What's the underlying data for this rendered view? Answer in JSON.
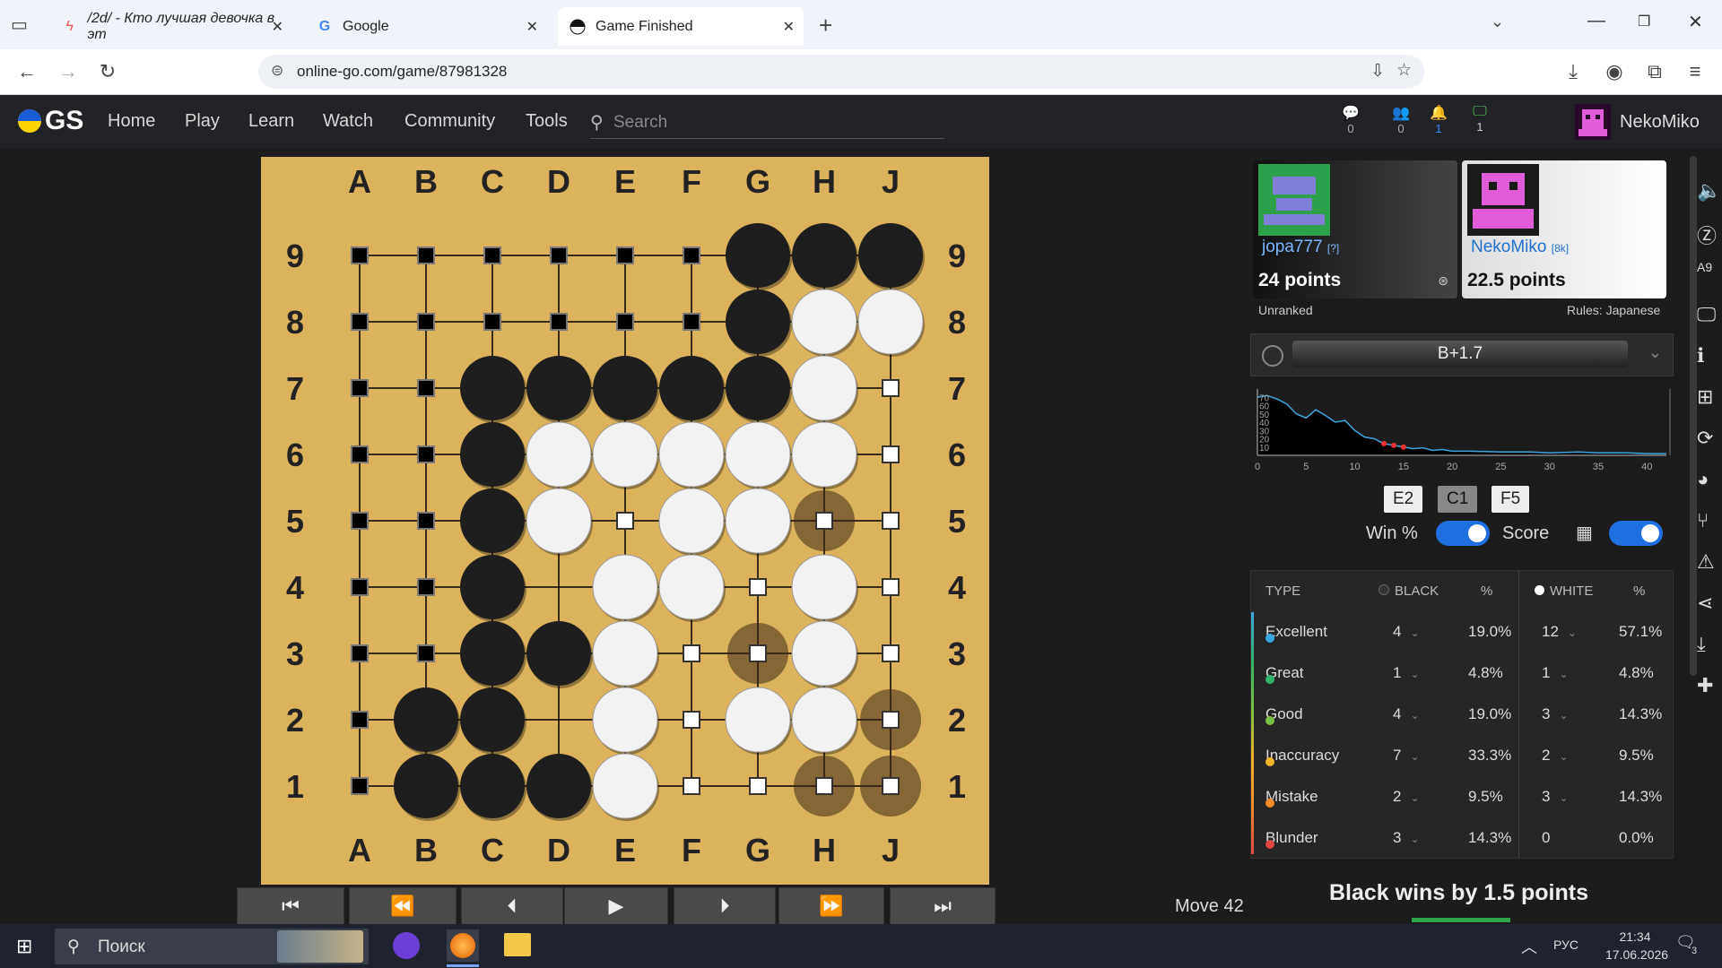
{
  "browser": {
    "tabs": [
      {
        "title": "/2d/ - Кто лучшая девочка в эт",
        "icon": "lightning-icon"
      },
      {
        "title": "Google",
        "icon": "google-icon"
      },
      {
        "title": "Game Finished",
        "icon": "ogs-game-icon"
      }
    ],
    "url": "online-go.com/game/87981328"
  },
  "site": {
    "logo": "GS",
    "menu": [
      "Home",
      "Play",
      "Learn",
      "Watch",
      "Community",
      "Tools"
    ],
    "search_placeholder": "Search",
    "counters": [
      {
        "icon": "chat-icon",
        "value": "0"
      },
      {
        "icon": "friends-icon",
        "value": "0"
      },
      {
        "icon": "bell-icon",
        "value": "1"
      },
      {
        "icon": "monitor-icon",
        "value": "1"
      }
    ],
    "user": "NekoMiko"
  },
  "board": {
    "columns": [
      "A",
      "B",
      "C",
      "D",
      "E",
      "F",
      "G",
      "H",
      "J"
    ],
    "rows": [
      "9",
      "8",
      "7",
      "6",
      "5",
      "4",
      "3",
      "2",
      "1"
    ],
    "stones": [
      "......BBB",
      "......BWW",
      "..BBBBBW.",
      "..BWWWWW.",
      "..BW.WW..",
      "..B.WW.W.",
      "..BBW..W.",
      ".BB.W.WWB",
      ".BBBW..W."
    ],
    "territory": [
      "bbbbbb...",
      "bbbbbb...",
      "bb......w",
      "bb......w",
      "bb..w..ww",
      "bb....w.w",
      "bb...wW.w",
      "b....w..w",
      "b....ww.w"
    ],
    "dead_notes": "H5, G3, H1, J2, J1 marked dead"
  },
  "controls": [
    "first-move",
    "back-10",
    "prev-move",
    "play",
    "next-move",
    "forward-10",
    "last-move"
  ],
  "move_label": "Move 42",
  "players": {
    "black": {
      "name": "jopa777",
      "rank": "[?]",
      "points": "24 points",
      "note": "Unranked"
    },
    "white": {
      "name": "NekoMiko",
      "rank": "[8k]",
      "points": "22.5 points",
      "note": "Rules: Japanese"
    }
  },
  "score_estimate": "B+1.7",
  "chart_data": {
    "type": "line",
    "x": [
      0,
      1,
      2,
      3,
      4,
      5,
      6,
      7,
      8,
      9,
      10,
      11,
      12,
      13,
      14,
      15,
      16,
      17,
      18,
      19,
      20,
      22,
      25,
      28,
      30,
      33,
      35,
      38,
      40,
      42
    ],
    "values": [
      70,
      72,
      68,
      62,
      50,
      45,
      55,
      48,
      40,
      42,
      30,
      22,
      20,
      14,
      12,
      10,
      8,
      9,
      6,
      7,
      5,
      5,
      4,
      4,
      3,
      4,
      3,
      3,
      2,
      2
    ],
    "xticks": [
      0,
      5,
      10,
      15,
      20,
      25,
      30,
      35,
      40
    ],
    "yticks": [
      10,
      20,
      30,
      40,
      50,
      60,
      70
    ],
    "markers_x": [
      13,
      14,
      15
    ]
  },
  "variations": [
    "E2",
    "C1",
    "F5"
  ],
  "toggles": {
    "win_label": "Win %",
    "score_label": "Score"
  },
  "table": {
    "headers": [
      "TYPE",
      "BLACK",
      "%",
      "WHITE",
      "%"
    ],
    "rows": [
      {
        "type": "Excellent",
        "color": "#3fa7e0",
        "b": "4",
        "bp": "19.0%",
        "w": "12",
        "wp": "57.1%"
      },
      {
        "type": "Great",
        "color": "#34b36b",
        "b": "1",
        "bp": "4.8%",
        "w": "1",
        "wp": "4.8%"
      },
      {
        "type": "Good",
        "color": "#7ac142",
        "b": "4",
        "bp": "19.0%",
        "w": "3",
        "wp": "14.3%"
      },
      {
        "type": "Inaccuracy",
        "color": "#f0b429",
        "b": "7",
        "bp": "33.3%",
        "w": "2",
        "wp": "9.5%"
      },
      {
        "type": "Mistake",
        "color": "#f08c2a",
        "b": "2",
        "bp": "9.5%",
        "w": "3",
        "wp": "14.3%"
      },
      {
        "type": "Blunder",
        "color": "#e04646",
        "b": "3",
        "bp": "14.3%",
        "w": "0",
        "wp": "0.0%"
      }
    ]
  },
  "result": "Black wins by 1.5 points",
  "taskbar": {
    "search": "Поиск",
    "lang": "РУС",
    "time": "21:34",
    "date": "17.06.2026",
    "notif": "3"
  }
}
